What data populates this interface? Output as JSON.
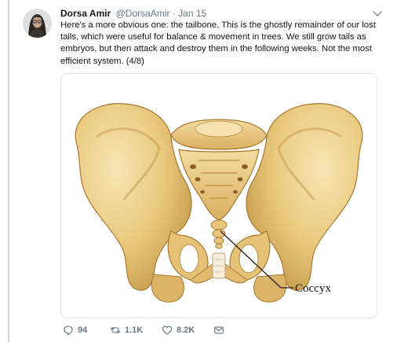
{
  "tweet": {
    "author_name": "Dorsa Amir",
    "author_handle": "@DorsaAmir",
    "separator": "·",
    "date": "Jan 15",
    "text": "Here's a more obvious one: the tailbone. This is the ghostly remainder of our lost tails, which were useful for balance & movement in trees. We still grow tails as embryos, but then attack and destroy them in the following weeks. Not the most efficient system. (4/8)",
    "image": {
      "label": "Coccyx"
    },
    "actions": {
      "replies": "94",
      "retweets": "1.1K",
      "likes": "8.2K"
    }
  },
  "icons": {
    "reply": "reply-icon",
    "retweet": "retweet-icon",
    "like": "heart-icon",
    "message": "envelope-icon",
    "caret": "chevron-down-icon"
  },
  "colors": {
    "bone_light": "#f1d99a",
    "bone_mid": "#e2bc6a",
    "bone_dark": "#b78a3c",
    "text_secondary": "#657786"
  }
}
